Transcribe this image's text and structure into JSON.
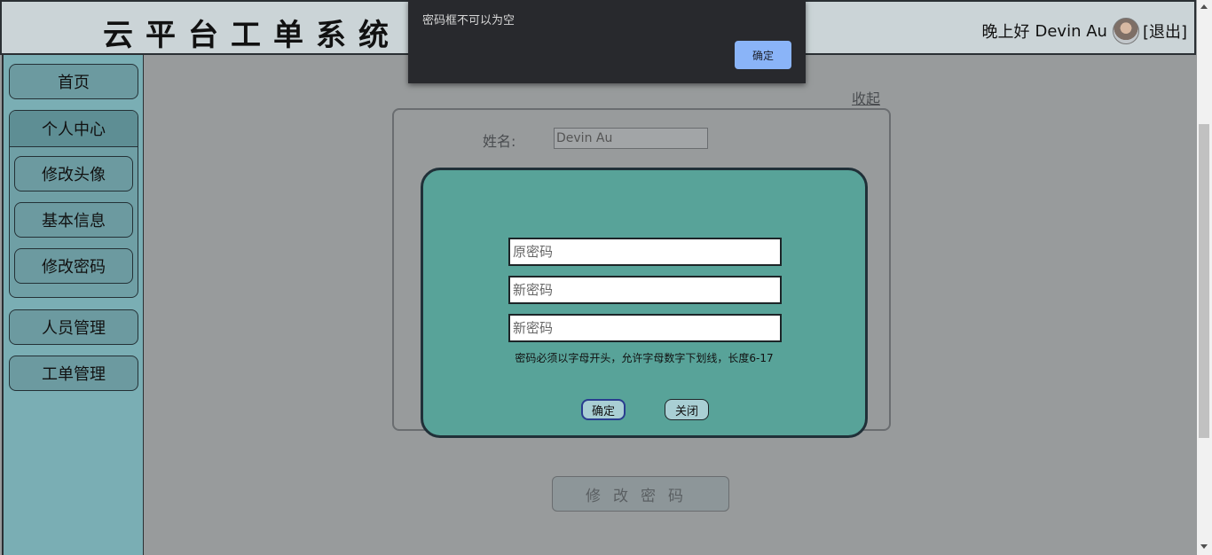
{
  "header": {
    "app_title": "云平台工单系统",
    "greeting": "晚上好",
    "user_name": "Devin Au",
    "logout_label": "[退出]"
  },
  "sidebar": {
    "home": "首页",
    "personal_center": "个人中心",
    "sub_items": [
      "修改头像",
      "基本信息",
      "修改密码"
    ],
    "staff_management": "人员管理",
    "ticket_management": "工单管理"
  },
  "main": {
    "collapse_label": "收起",
    "name_label": "姓名:",
    "name_value": "Devin Au",
    "change_password_button": "修改密码"
  },
  "password_modal": {
    "old_password_placeholder": "原密码",
    "new_password_placeholder": "新密码",
    "confirm_password_placeholder": "新密码",
    "hint": "密码必须以字母开头，允许字母数字下划线，长度6-17",
    "confirm_label": "确定",
    "close_label": "关闭"
  },
  "alert": {
    "message": "密码框不可以为空",
    "ok_label": "确定"
  },
  "colors": {
    "sidebar": "#7aaeb4",
    "modal": "#58a399",
    "alert_button": "#8ab4f8"
  }
}
